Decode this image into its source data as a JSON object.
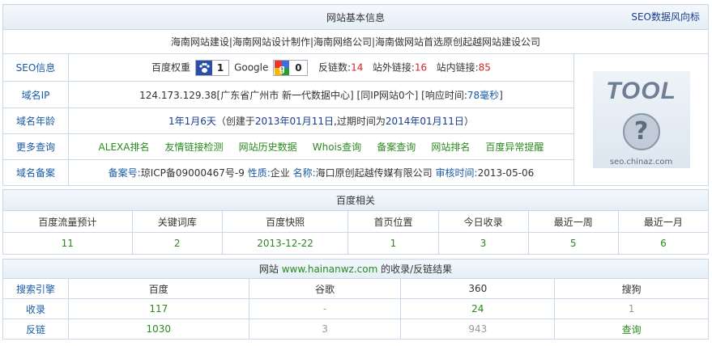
{
  "header": {
    "title": "网站基本信息",
    "seo_link": "SEO数据风向标"
  },
  "site_title": "海南网站建设|海南网站设计制作|海南网络公司|海南做网站首选原创起越网站建设公司",
  "seo": {
    "label": "SEO信息",
    "baidu_label": "百度权重",
    "baidu_value": "1",
    "google_label": "Google",
    "google_value": "0",
    "backlinks_label": "反链数:",
    "backlinks_value": "14",
    "external_label": "站外链接:",
    "external_value": "16",
    "internal_label": "站内链接:",
    "internal_value": "85"
  },
  "ip": {
    "label": "域名IP",
    "text": "124.173.129.38[广东省广州市 新一代数据中心] [同IP网站0个] [响应时间:",
    "time": "78毫秒",
    "end": "]"
  },
  "age": {
    "label": "域名年龄",
    "value": "1年1月6天",
    "p1": "（创建于",
    "created": "2013年01月11日",
    "p2": ",过期时间为",
    "expire": "2014年01月11日",
    "p3": "）"
  },
  "more": {
    "label": "更多查询",
    "links": [
      "ALEXA排名",
      "友情链接检测",
      "网站历史数据",
      "Whois查询",
      "备案查询",
      "网站排名",
      "百度异常提醒"
    ]
  },
  "icp": {
    "label": "域名备案",
    "no_label": "备案号:",
    "no_value": "琼ICP备09000467号-9",
    "nature_label": "性质:",
    "nature_value": "企业",
    "name_label": "名称:",
    "name_value": "海口原创起越传媒有限公司",
    "date_label": "审核时间:",
    "date_value": "2013-05-06"
  },
  "logo": {
    "word": "TOOL",
    "url": "seo.chinaz.com"
  },
  "baidu": {
    "title": "百度相关",
    "headers": [
      "百度流量预计",
      "关键词库",
      "百度快照",
      "首页位置",
      "今日收录",
      "最近一周",
      "最近一月"
    ],
    "values": [
      "11",
      "2",
      "2013-12-22",
      "1",
      "3",
      "5",
      "6"
    ]
  },
  "index": {
    "t1": "网站",
    "domain": "www.hainanwz.com",
    "t2": "的收录/反链结果",
    "headers": [
      "搜索引擎",
      "百度",
      "谷歌",
      "360",
      "搜狗"
    ],
    "rows": [
      {
        "label": "收录",
        "values": [
          "117",
          "-",
          "24",
          "1"
        ]
      },
      {
        "label": "反链",
        "values": [
          "1030",
          "3",
          "943",
          "查询"
        ]
      }
    ]
  },
  "colors": {
    "label_blue": "#1a5ba5",
    "red": "#dd2222",
    "green": "#2a8a1e",
    "border": "#c9d7e8"
  }
}
